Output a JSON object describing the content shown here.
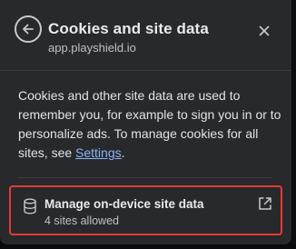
{
  "header": {
    "title": "Cookies and site data",
    "subtitle": "app.playshield.io",
    "back_icon": "arrow-left-icon",
    "close_icon": "close-icon"
  },
  "body": {
    "description_prefix": "Cookies and other site data are used to remember you, for example to sign you in or to personalize ads. To manage cookies for all sites, see ",
    "settings_link": "Settings",
    "description_suffix": "."
  },
  "manage": {
    "label": "Manage on-device site data",
    "sublabel": "4 sites allowed",
    "icon": "database-icon",
    "external_icon": "open-in-new-icon"
  },
  "colors": {
    "panel": "#28292c",
    "text": "#e8eaed",
    "link": "#8ab4f8",
    "highlight_border": "#e53935"
  }
}
